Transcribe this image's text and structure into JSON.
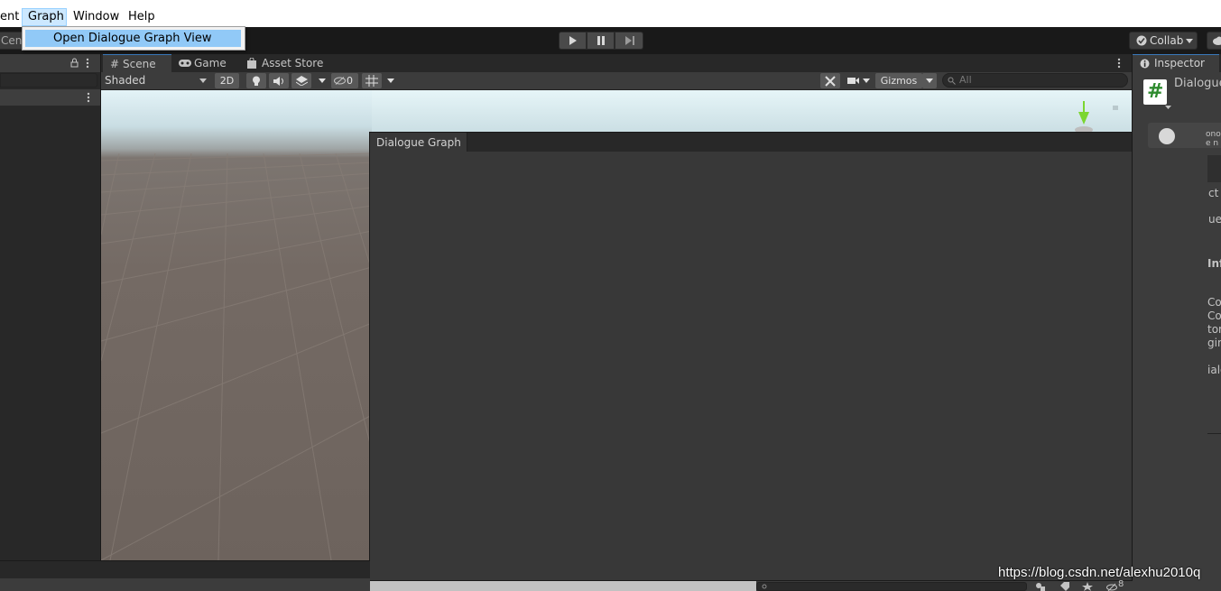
{
  "menubar": {
    "items": [
      {
        "label": "ent"
      },
      {
        "label": "Graph"
      },
      {
        "label": "Window"
      },
      {
        "label": "Help"
      }
    ],
    "dropdown_item": "Open Dialogue Graph View"
  },
  "toolbar": {
    "left_label": "Cent",
    "collab_label": "Collab"
  },
  "scene": {
    "tabs": [
      {
        "label": "Scene"
      },
      {
        "label": "Game"
      },
      {
        "label": "Asset Store"
      }
    ],
    "shading_mode": "Shaded",
    "mode_2d": "2D",
    "hidden_count": "0",
    "gizmos_label": "Gizmos",
    "search_placeholder": "All"
  },
  "dialogue_graph": {
    "title": "Dialogue Graph"
  },
  "inspector": {
    "tab_label": "Inspector",
    "object_name": "Dialogue",
    "partial_lines": [
      "ono",
      "e n",
      "ct",
      "ue",
      "Inf",
      "Co",
      "Co",
      "tor",
      "gin",
      "ialo"
    ]
  },
  "status": {
    "hidden_count": "8"
  },
  "watermark": "https://blog.csdn.net/alexhu2010q",
  "colors": {
    "accent": "#3a79bb",
    "menu_highlight": "#91c9f7",
    "panel_dark": "#282828",
    "panel": "#3c3c3c",
    "graph_bg": "#383838"
  }
}
